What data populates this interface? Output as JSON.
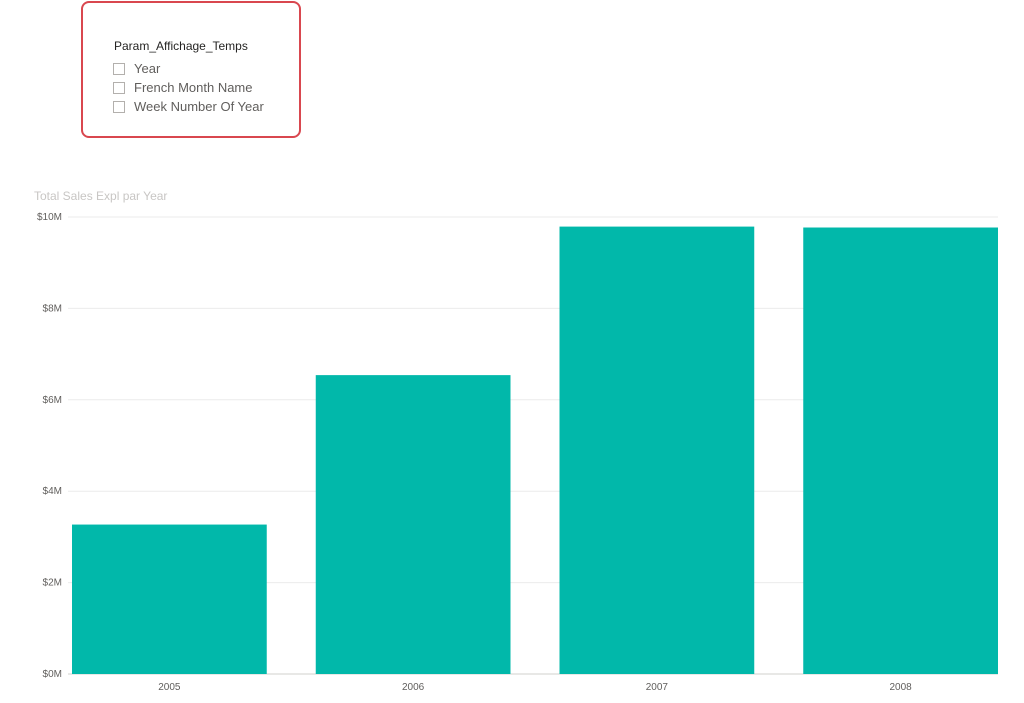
{
  "slicer": {
    "title": "Param_Affichage_Temps",
    "border_color": "#d9474f",
    "items": [
      {
        "label": "Year",
        "checked": false
      },
      {
        "label": "French Month Name",
        "checked": false
      },
      {
        "label": "Week Number Of Year",
        "checked": false
      }
    ]
  },
  "chart_data": {
    "type": "bar",
    "title": "Total Sales Expl par Year",
    "categories": [
      "2005",
      "2006",
      "2007",
      "2008"
    ],
    "values": [
      3270000,
      6540000,
      9790000,
      9770000
    ],
    "ylim": [
      0,
      10000000
    ],
    "yticks": [
      0,
      2000000,
      4000000,
      6000000,
      8000000,
      10000000
    ],
    "ytick_labels": [
      "$0M",
      "$2M",
      "$4M",
      "$6M",
      "$8M",
      "$10M"
    ],
    "grid": true,
    "bar_color": "#01b8aa"
  }
}
